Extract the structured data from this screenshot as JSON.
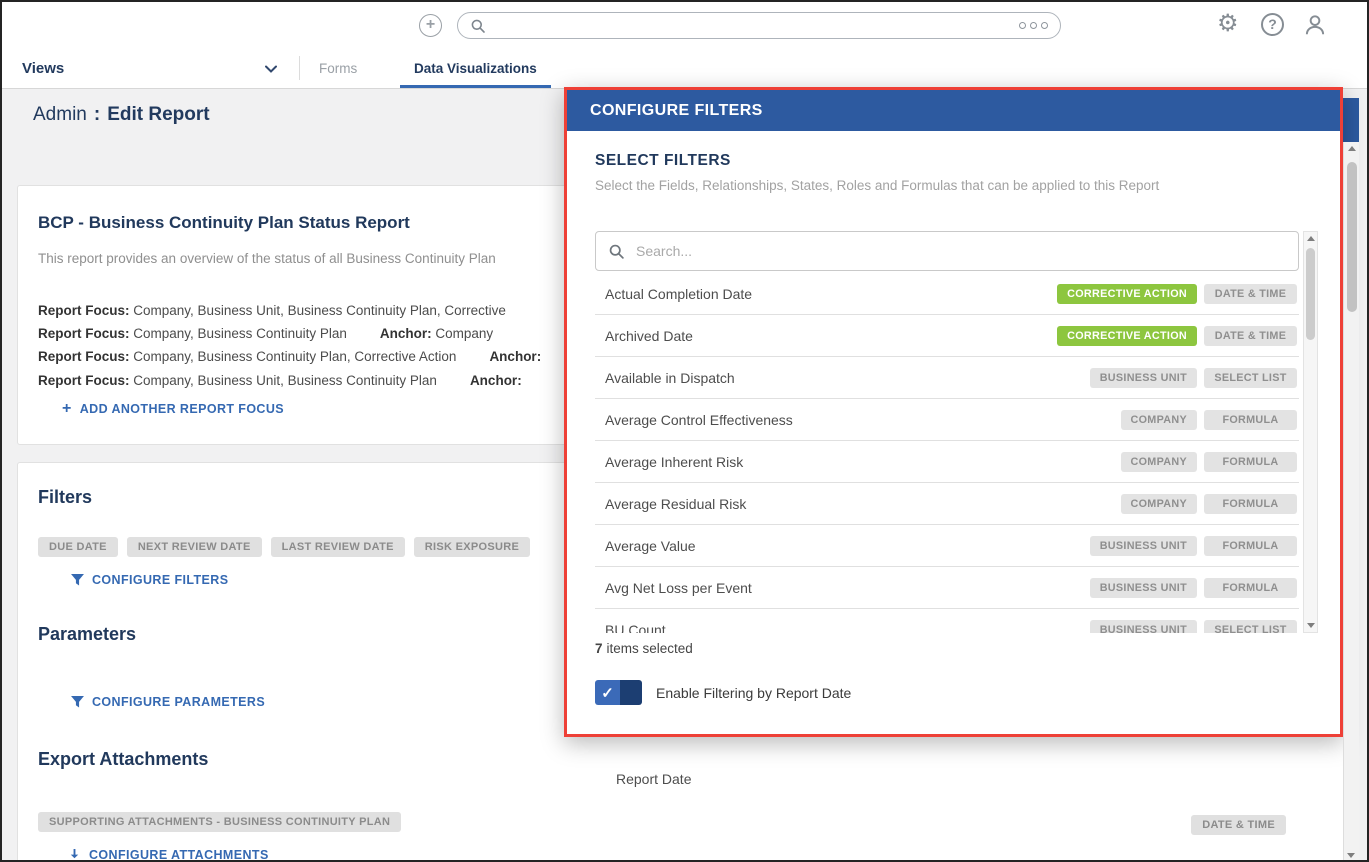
{
  "colors": {
    "accent_blue": "#3569b2",
    "modal_header_blue": "#2d5aa0",
    "highlight_red": "#ee4037",
    "tag_green": "#8dc63f",
    "heading_navy": "#21395c"
  },
  "icons": {
    "add": "+",
    "settings": "⚙",
    "help": "?",
    "check": "✓"
  },
  "topbar": {
    "search_placeholder": ""
  },
  "nav": {
    "views_label": "Views",
    "tabs": [
      {
        "label": "Forms",
        "active": false
      },
      {
        "label": "Data Visualizations",
        "active": true
      }
    ]
  },
  "page": {
    "section": "Admin",
    "separator": ":",
    "title": "Edit Report"
  },
  "report_card": {
    "title": "BCP - Business Continuity Plan Status Report",
    "description": "This report provides an overview of the status of all Business Continuity Plan",
    "focus_rows": [
      {
        "label": "Report Focus:",
        "value": "Company, Business Unit, Business Continuity Plan, Corrective",
        "anchor_label": "",
        "anchor_value": ""
      },
      {
        "label": "Report Focus:",
        "value": "Company, Business Continuity Plan",
        "anchor_label": "Anchor:",
        "anchor_value": "Company"
      },
      {
        "label": "Report Focus:",
        "value": "Company, Business Continuity Plan, Corrective Action",
        "anchor_label": "Anchor:",
        "anchor_value": ""
      },
      {
        "label": "Report Focus:",
        "value": "Company, Business Unit, Business Continuity Plan",
        "anchor_label": "Anchor:",
        "anchor_value": ""
      }
    ],
    "add_button": "ADD ANOTHER REPORT FOCUS"
  },
  "filters_section": {
    "title": "Filters",
    "pills": [
      "DUE DATE",
      "NEXT REVIEW DATE",
      "LAST REVIEW DATE",
      "RISK EXPOSURE"
    ],
    "configure_button": "CONFIGURE FILTERS"
  },
  "parameters_section": {
    "title": "Parameters",
    "configure_button": "CONFIGURE PARAMETERS"
  },
  "attachments_section": {
    "title": "Export Attachments",
    "pills": [
      "SUPPORTING ATTACHMENTS - BUSINESS CONTINUITY PLAN"
    ],
    "configure_button": "CONFIGURE ATTACHMENTS"
  },
  "modal": {
    "title": "CONFIGURE FILTERS",
    "section_title": "SELECT FILTERS",
    "subtitle": "Select the Fields, Relationships, States, Roles and Formulas that can be applied to this Report",
    "search_placeholder": "Search...",
    "filter_rows": [
      {
        "label": "Actual Completion Date",
        "tags": [
          {
            "text": "CORRECTIVE ACTION",
            "style": "green"
          },
          {
            "text": "DATE & TIME",
            "style": "gray"
          }
        ]
      },
      {
        "label": "Archived Date",
        "tags": [
          {
            "text": "CORRECTIVE ACTION",
            "style": "green"
          },
          {
            "text": "DATE & TIME",
            "style": "gray"
          }
        ]
      },
      {
        "label": "Available in Dispatch",
        "tags": [
          {
            "text": "BUSINESS UNIT",
            "style": "gray"
          },
          {
            "text": "SELECT LIST",
            "style": "gray"
          }
        ]
      },
      {
        "label": "Average Control Effectiveness",
        "tags": [
          {
            "text": "COMPANY",
            "style": "gray"
          },
          {
            "text": "FORMULA",
            "style": "gray"
          }
        ]
      },
      {
        "label": "Average Inherent Risk",
        "tags": [
          {
            "text": "COMPANY",
            "style": "gray"
          },
          {
            "text": "FORMULA",
            "style": "gray"
          }
        ]
      },
      {
        "label": "Average Residual Risk",
        "tags": [
          {
            "text": "COMPANY",
            "style": "gray"
          },
          {
            "text": "FORMULA",
            "style": "gray"
          }
        ]
      },
      {
        "label": "Average Value",
        "tags": [
          {
            "text": "BUSINESS UNIT",
            "style": "gray"
          },
          {
            "text": "FORMULA",
            "style": "gray"
          }
        ]
      },
      {
        "label": "Avg Net Loss per Event",
        "tags": [
          {
            "text": "BUSINESS UNIT",
            "style": "gray"
          },
          {
            "text": "FORMULA",
            "style": "gray"
          }
        ]
      },
      {
        "label": "BU Count",
        "tags": [
          {
            "text": "BUSINESS UNIT",
            "style": "gray"
          },
          {
            "text": "SELECT LIST",
            "style": "gray"
          }
        ]
      }
    ],
    "selected_count": "7",
    "selected_label": "items selected",
    "report_date_toggle": {
      "checked": true,
      "label": "Enable Filtering by Report Date"
    }
  },
  "background_panel": {
    "field_label": "Report Date",
    "tag": "DATE & TIME"
  }
}
